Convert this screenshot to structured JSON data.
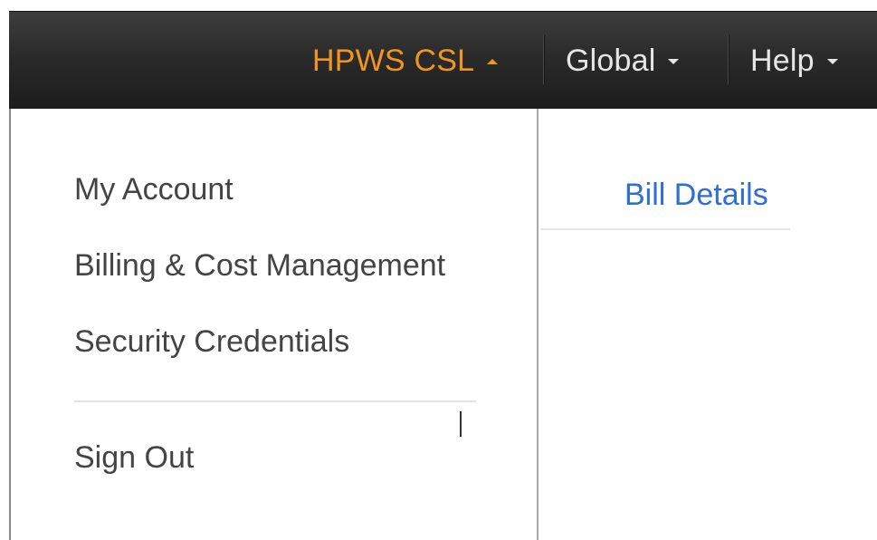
{
  "navbar": {
    "account_label": "HPWS CSL",
    "region_label": "Global",
    "help_label": "Help"
  },
  "account_menu": {
    "items": [
      {
        "label": "My Account"
      },
      {
        "label": "Billing & Cost Management"
      },
      {
        "label": "Security Credentials"
      },
      {
        "label": "Sign Out"
      }
    ]
  },
  "page": {
    "link_label": "Bill Details"
  },
  "colors": {
    "navbar_bg": "#2b2b2b",
    "account_accent": "#f0961e",
    "nav_text": "#e6e6e6",
    "menu_text": "#444444",
    "link": "#2f6fd1"
  },
  "icons": {
    "account_caret": "caret-up-icon",
    "region_caret": "caret-down-icon",
    "help_caret": "caret-down-icon"
  }
}
